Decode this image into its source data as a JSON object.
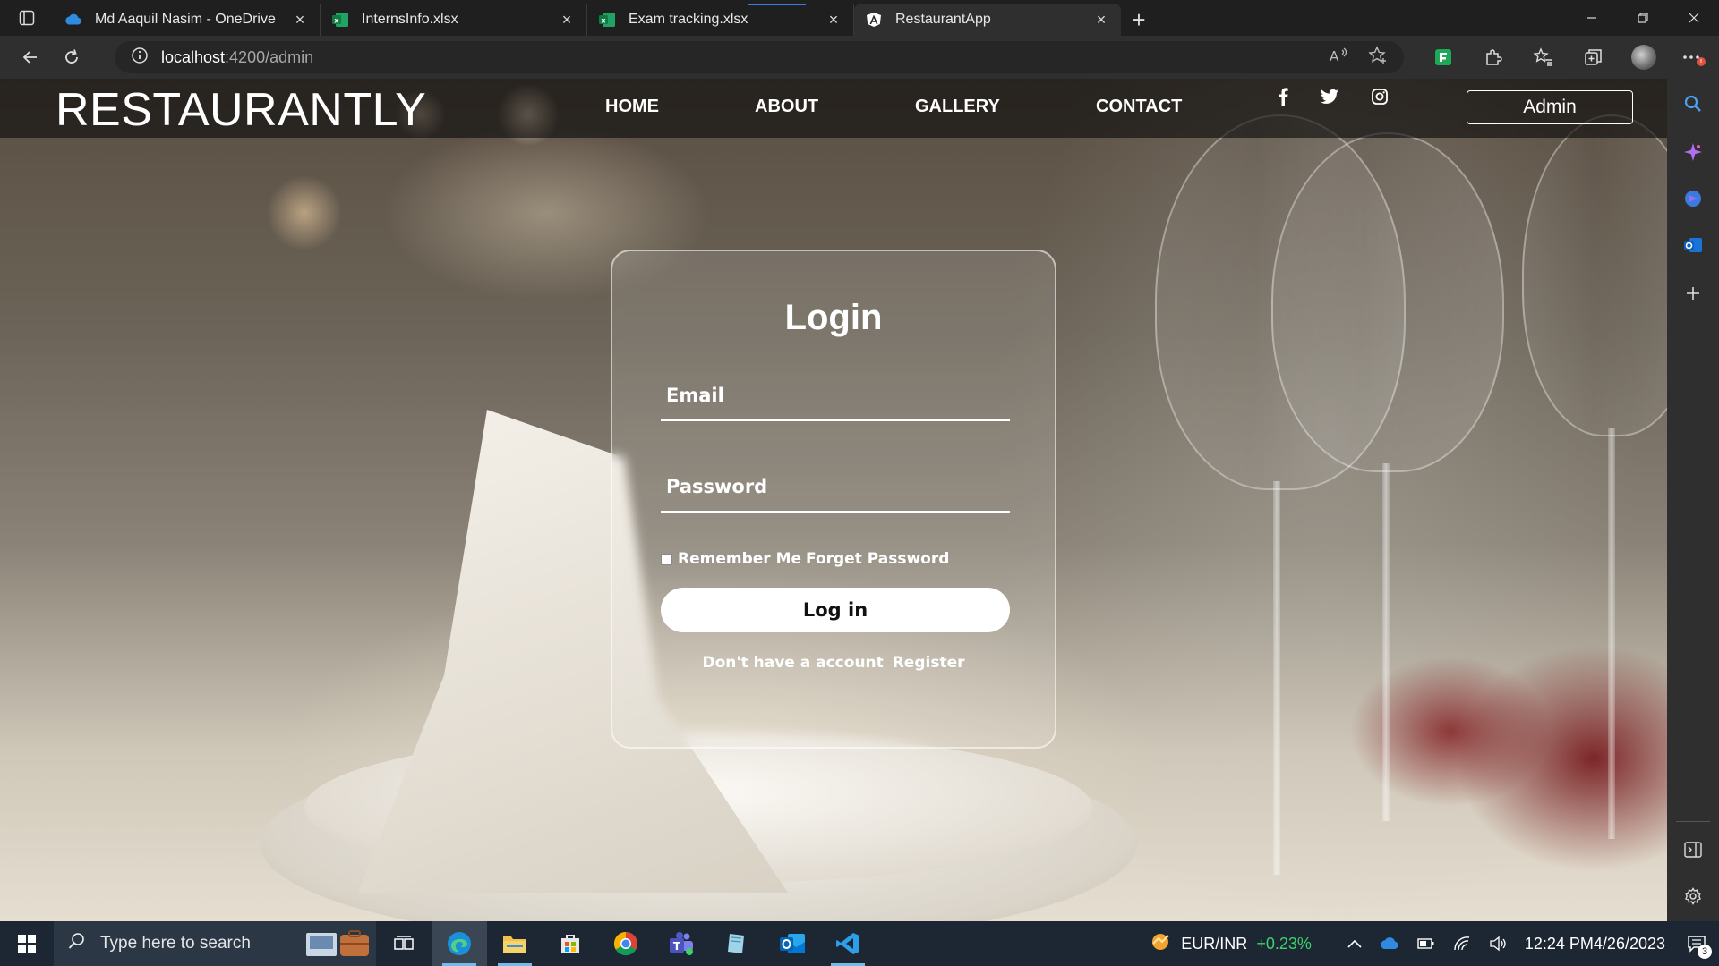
{
  "browser": {
    "tabs": [
      {
        "title": "Md Aaquil Nasim - OneDrive",
        "icon": "onedrive-icon",
        "active": false
      },
      {
        "title": "InternsInfo.xlsx",
        "icon": "excel-icon",
        "active": false
      },
      {
        "title": "Exam tracking.xlsx",
        "icon": "excel-icon",
        "active": false
      },
      {
        "title": "RestaurantApp",
        "icon": "angular-icon",
        "active": true
      }
    ],
    "address": {
      "host": "localhost",
      "path": ":4200/admin"
    }
  },
  "site": {
    "brand": "RESTAURANTLY",
    "nav": {
      "home": "HOME",
      "about": "ABOUT",
      "gallery": "GALLERY",
      "contact": "CONTACT"
    },
    "admin_label": "Admin"
  },
  "login": {
    "title": "Login",
    "email_placeholder": "Email",
    "password_placeholder": "Password",
    "remember_label": "Remember Me",
    "forget_label": "Forget Password",
    "submit_label": "Log in",
    "no_account_text": "Don't have a account",
    "register_label": "Register"
  },
  "taskbar": {
    "search_placeholder": "Type here to search",
    "ticker_name": "EUR/INR",
    "ticker_change": "+0.23%",
    "time": "12:24 PM",
    "date": "4/26/2023",
    "notification_count": "3"
  },
  "colors": {
    "accent": "#3b7ddd",
    "ticker_positive": "#3fd16a"
  }
}
